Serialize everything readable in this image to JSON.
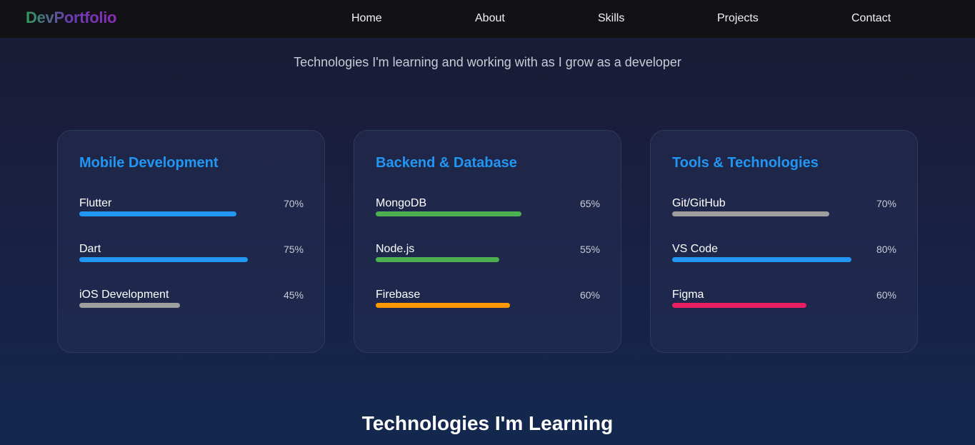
{
  "logo": {
    "text_dev": "Dev",
    "text_portfolio": "Portfolio"
  },
  "nav": [
    {
      "label": "Home"
    },
    {
      "label": "About"
    },
    {
      "label": "Skills"
    },
    {
      "label": "Projects"
    },
    {
      "label": "Contact"
    }
  ],
  "subtitle": "Technologies I'm learning and working with as I grow as a developer",
  "cards": [
    {
      "title": "Mobile Development",
      "skills": [
        {
          "name": "Flutter",
          "percent_label": "70%",
          "level": 70,
          "color": "#2196f3"
        },
        {
          "name": "Dart",
          "percent_label": "75%",
          "level": 75,
          "color": "#2196f3"
        },
        {
          "name": "iOS Development",
          "percent_label": "45%",
          "level": 45,
          "color": "#9e9e9e"
        }
      ]
    },
    {
      "title": "Backend & Database",
      "skills": [
        {
          "name": "MongoDB",
          "percent_label": "65%",
          "level": 65,
          "color": "#4caf50"
        },
        {
          "name": "Node.js",
          "percent_label": "55%",
          "level": 55,
          "color": "#4caf50"
        },
        {
          "name": "Firebase",
          "percent_label": "60%",
          "level": 60,
          "color": "#ff9800"
        }
      ]
    },
    {
      "title": "Tools & Technologies",
      "skills": [
        {
          "name": "Git/GitHub",
          "percent_label": "70%",
          "level": 70,
          "color": "#9e9e9e"
        },
        {
          "name": "VS Code",
          "percent_label": "80%",
          "level": 80,
          "color": "#2196f3"
        },
        {
          "name": "Figma",
          "percent_label": "60%",
          "level": 60,
          "color": "#e91e63"
        }
      ]
    }
  ],
  "section_heading": "Technologies I'm Learning"
}
